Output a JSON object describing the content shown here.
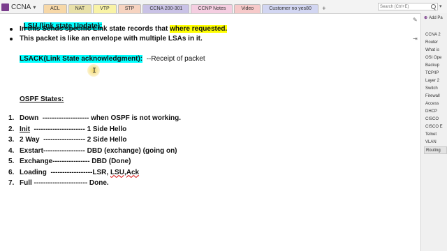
{
  "notebook": {
    "name": "CCNA"
  },
  "tabs": [
    {
      "label": "ACL",
      "color": "#f7d8a8"
    },
    {
      "label": "NAT",
      "color": "#e8e0a8"
    },
    {
      "label": "VTP",
      "color": "#f9f3a6"
    },
    {
      "label": "STP",
      "color": "#f6d3c0"
    },
    {
      "label": "CCNA 200-301",
      "color": "#c9c2e6"
    },
    {
      "label": "CCNP Notes",
      "color": "#f4cde0"
    },
    {
      "label": "Video",
      "color": "#f6c9c9"
    },
    {
      "label": "Customer no yes80",
      "color": "#d2d6f2"
    }
  ],
  "add_tab": "+",
  "search": {
    "placeholder": "Search (Ctrl+E)"
  },
  "page_panel": {
    "add_page": "Add Pa",
    "pages": [
      "CCNA 2",
      "Router",
      "What is",
      "OSI Ope",
      "Backup",
      "TCP/IP",
      "Layer 2",
      "Switch",
      "Firewall",
      "Access",
      "DHCP",
      "CISCO",
      "CISCO E",
      "Telnet",
      "VLAN",
      "Routing"
    ],
    "selected": "Routing"
  },
  "content": {
    "lsu_heading": "LSU (link state Update):",
    "bullet1_a": "In this Sends specific Link state records that ",
    "bullet1_b": "where requested.",
    "bullet2": "This packet is like an envelope with multiple LSAs in it.",
    "lsack_heading": "LSACK(Link State acknowledgment):",
    "lsack_desc": "  --Receipt of packet",
    "states_heading": "OSPF States:",
    "states": [
      {
        "n": "1.",
        "pre": "",
        "name": "Down",
        "rest": "  -------------------- when OSPF is not working."
      },
      {
        "n": "2.",
        "pre": "",
        "name": "Init",
        "rest": "  ---------------------- 1 Side Hello"
      },
      {
        "n": "3.",
        "pre": "",
        "name": "2 Way",
        "rest": "  ------------------ 2 Side Hello"
      },
      {
        "n": "4.",
        "pre": "",
        "name": "Exstart",
        "rest": "------------------ DBD (exchange) (going on)"
      },
      {
        "n": "5.",
        "pre": "",
        "name": "Exchange",
        "rest": "---------------- DBD (Done)"
      },
      {
        "n": "6.",
        "pre": "",
        "name": "Loading",
        "rest": "  ------------------LSR, "
      },
      {
        "n": "7.",
        "pre": "",
        "name": "Full",
        "rest": " ----------------------- Done."
      }
    ],
    "loading_lsu": "LSU,Ack"
  }
}
